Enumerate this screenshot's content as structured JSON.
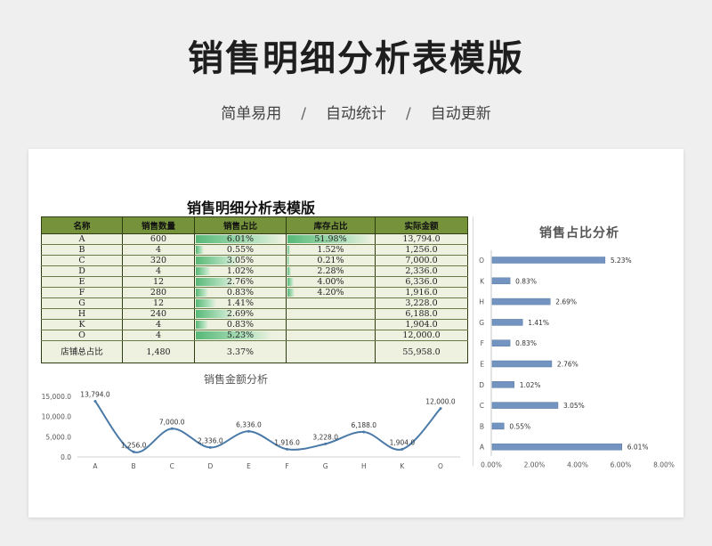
{
  "header": {
    "title": "销售明细分析表模版",
    "tags": [
      "简单易用",
      "自动统计",
      "自动更新"
    ],
    "separator": "/"
  },
  "sheet": {
    "title": "销售明细分析表模版",
    "columns": [
      "名称",
      "销售数量",
      "销售占比",
      "库存占比",
      "实际金额"
    ],
    "rows": [
      {
        "name": "A",
        "qty": "600",
        "share": "6.01%",
        "share_val": 6.01,
        "stock": "51.98%",
        "stock_val": 51.98,
        "amount": "13,794.0"
      },
      {
        "name": "B",
        "qty": "4",
        "share": "0.55%",
        "share_val": 0.55,
        "stock": "1.52%",
        "stock_val": 1.52,
        "amount": "1,256.0"
      },
      {
        "name": "C",
        "qty": "320",
        "share": "3.05%",
        "share_val": 3.05,
        "stock": "0.21%",
        "stock_val": 0.21,
        "amount": "7,000.0"
      },
      {
        "name": "D",
        "qty": "4",
        "share": "1.02%",
        "share_val": 1.02,
        "stock": "2.28%",
        "stock_val": 2.28,
        "amount": "2,336.0"
      },
      {
        "name": "E",
        "qty": "12",
        "share": "2.76%",
        "share_val": 2.76,
        "stock": "4.00%",
        "stock_val": 4.0,
        "amount": "6,336.0"
      },
      {
        "name": "F",
        "qty": "280",
        "share": "0.83%",
        "share_val": 0.83,
        "stock": "4.20%",
        "stock_val": 4.2,
        "amount": "1,916.0"
      },
      {
        "name": "G",
        "qty": "12",
        "share": "1.41%",
        "share_val": 1.41,
        "stock": "",
        "stock_val": 0,
        "amount": "3,228.0"
      },
      {
        "name": "H",
        "qty": "240",
        "share": "2.69%",
        "share_val": 2.69,
        "stock": "",
        "stock_val": 0,
        "amount": "6,188.0"
      },
      {
        "name": "K",
        "qty": "4",
        "share": "0.83%",
        "share_val": 0.83,
        "stock": "",
        "stock_val": 0,
        "amount": "1,904.0"
      },
      {
        "name": "O",
        "qty": "4",
        "share": "5.23%",
        "share_val": 5.23,
        "stock": "",
        "stock_val": 0,
        "amount": "12,000.0"
      }
    ],
    "total": {
      "label": "店铺总占比",
      "qty": "1,480",
      "share": "3.37%",
      "stock": "",
      "amount": "55,958.0"
    }
  },
  "colors": {
    "header_green": "#76933c",
    "row_bg": "#eef1e0",
    "data_bar": "#57b877",
    "series_blue": "#4a7aa8",
    "bar_blue": "#7394c0"
  },
  "chart_data": [
    {
      "type": "line",
      "title": "销售金额分析",
      "categories": [
        "A",
        "B",
        "C",
        "D",
        "E",
        "F",
        "G",
        "H",
        "K",
        "O"
      ],
      "values": [
        13794.0,
        1256.0,
        7000.0,
        2336.0,
        6336.0,
        1916.0,
        3228.0,
        6188.0,
        1904.0,
        12000.0
      ],
      "data_labels": [
        "13,794.0",
        "1,256.0",
        "7,000.0",
        "2,336.0",
        "6,336.0",
        "1,916.0",
        "3,228.0",
        "6,188.0",
        "1,904.0",
        "12,000.0"
      ],
      "yticks": [
        "15,000.0",
        "10,000.0",
        "5,000.0",
        "0.0"
      ],
      "ylim": [
        0,
        15000
      ],
      "smooth": true
    },
    {
      "type": "bar",
      "orientation": "horizontal",
      "title": "销售占比分析",
      "categories": [
        "O",
        "K",
        "H",
        "G",
        "F",
        "E",
        "D",
        "C",
        "B",
        "A"
      ],
      "values": [
        5.23,
        0.83,
        2.69,
        1.41,
        0.83,
        2.76,
        1.02,
        3.05,
        0.55,
        6.01
      ],
      "data_labels": [
        "5.23%",
        "0.83%",
        "2.69%",
        "1.41%",
        "0.83%",
        "2.76%",
        "1.02%",
        "3.05%",
        "0.55%",
        "6.01%"
      ],
      "xticks": [
        "0.00%",
        "2.00%",
        "4.00%",
        "6.00%",
        "8.00%"
      ],
      "xlim": [
        0,
        8
      ]
    }
  ]
}
